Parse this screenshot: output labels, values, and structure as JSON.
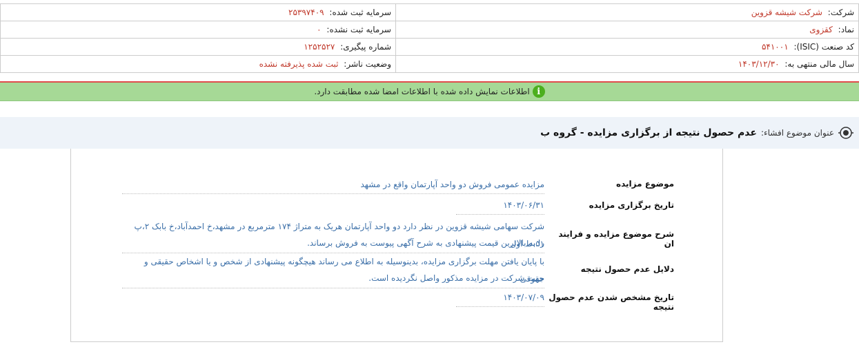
{
  "header": {
    "company_label": "شرکت:",
    "company_value": "شرکت شیشه قزوین",
    "capital_label": "سرمایه ثبت شده:",
    "capital_value": "۲۵۳۹۷۴۰۹",
    "symbol_label": "نماد:",
    "symbol_value": "کقزوی",
    "unregistered_capital_label": "سرمایه ثبت نشده:",
    "unregistered_capital_value": "۰",
    "isic_label": "کد صنعت (ISIC):",
    "isic_value": "۵۴۱۰۰۱",
    "tracking_label": "شماره پیگیری:",
    "tracking_value": "۱۲۵۲۵۲۷",
    "fiscal_label": "سال مالی منتهی به:",
    "fiscal_value": "۱۴۰۳/۱۲/۳۰",
    "publisher_status_label": "وضعیت ناشر:",
    "publisher_status_value": "ثبت شده پذیرفته نشده"
  },
  "notice": {
    "text": "اطلاعات نمایش داده شده با اطلاعات امضا شده مطابقت دارد."
  },
  "subject": {
    "label": "عنوان موضوع افشاء:",
    "title": "عدم حصول نتیجه از برگزاری مزایده - گروه ب"
  },
  "details": {
    "auction_subject_label": "موضوع مزایده",
    "auction_subject_value": "مزایده عمومی فروش دو واحد آپارتمان واقع در مشهد",
    "auction_date_label": "تاریخ برگزاری مزایده",
    "auction_date_value": "۱۴۰۳/۰۶/۳۱",
    "description_label": "شرح موضوع مزایده و فرایند ان",
    "description_value_1": "شرکت سهامی شیشه قزوین در نظر دارد دو واحد آپارتمان هریک به متراژ ۱۷۴ مترمربع در مشهد،خ احمدآباد،خ بابک ۲،پ ۵۱،ط اول",
    "description_value_2": "را به بالاترین قیمت پیشنهادی به شرح آگهی پیوست به فروش برساند.",
    "reasons_label": "دلایل عدم حصول نتیجه",
    "reasons_value_1": "با پایان یافتن مهلت برگزاری مزایده، بدینوسیله به اطلاع می رساند هیچگونه پیشنهادی از شخص و یا اشخاص حقیقی و حقوقی",
    "reasons_value_2": "جهت شرکت در مزایده مذکور واصل نگردیده است.",
    "result_date_label": "تاریخ مشخص شدن عدم حصول نتیجه",
    "result_date_value": "۱۴۰۳/۰۷/۰۹"
  }
}
